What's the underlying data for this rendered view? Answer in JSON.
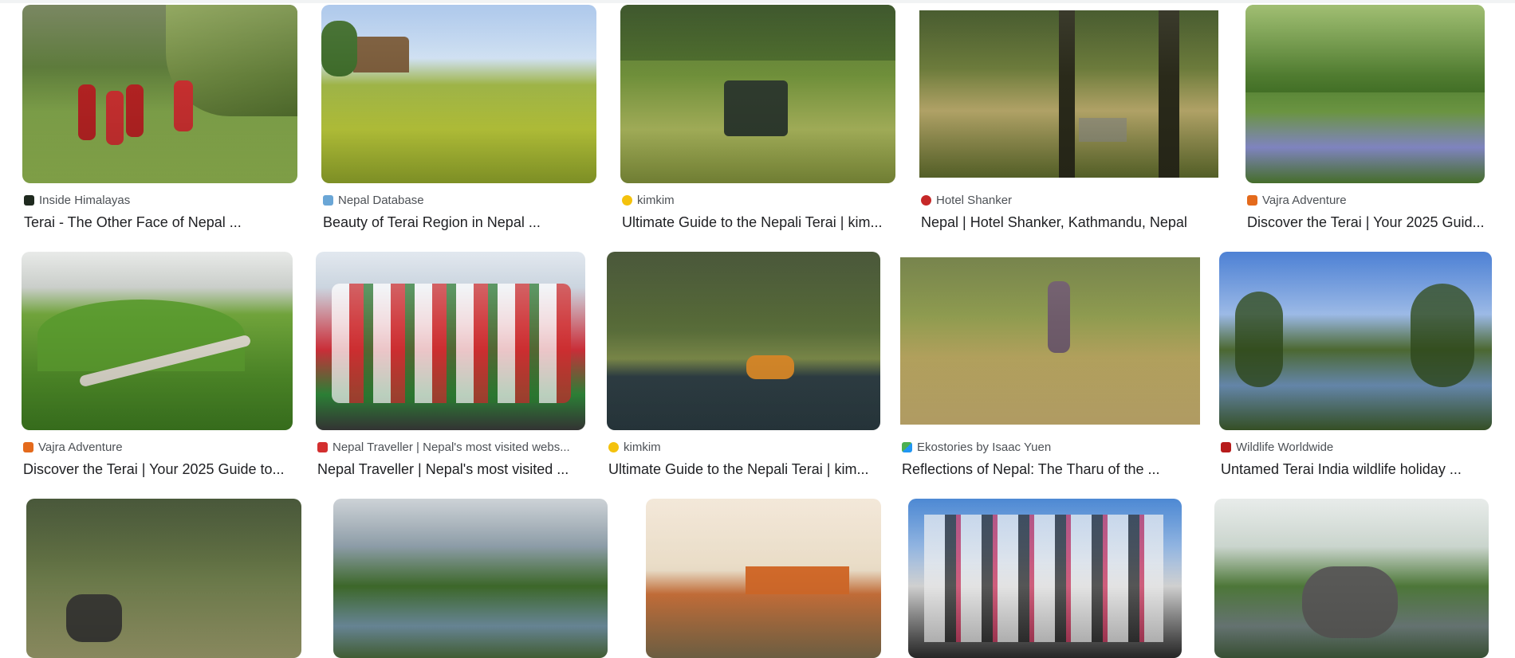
{
  "results": [
    {
      "source": "Inside Himalayas",
      "title": "Terai - The Other Face of Nepal ...",
      "favicon_color": "#1f2a1f",
      "favicon_icon": "inside-himalayas-favicon"
    },
    {
      "source": "Nepal Database",
      "title": "Beauty of Terai Region in Nepal ...",
      "favicon_color": "#6aa6d6",
      "favicon_icon": "nepal-database-favicon"
    },
    {
      "source": "kimkim",
      "title": "Ultimate Guide to the Nepali Terai | kim...",
      "favicon_color": "#f4c20d",
      "favicon_icon": "kimkim-favicon"
    },
    {
      "source": "Hotel Shanker",
      "title": "Nepal | Hotel Shanker, Kathmandu, Nepal",
      "favicon_color": "#c62828",
      "favicon_icon": "hotel-shanker-favicon"
    },
    {
      "source": "Vajra Adventure",
      "title": "Discover the Terai | Your 2025 Guid...",
      "favicon_color": "#e46a1c",
      "favicon_icon": "vajra-adventure-favicon"
    },
    {
      "source": "Vajra Adventure",
      "title": "Discover the Terai | Your 2025 Guide to...",
      "favicon_color": "#e46a1c",
      "favicon_icon": "vajra-adventure-favicon"
    },
    {
      "source": "Nepal Traveller | Nepal's most visited webs...",
      "title": "Nepal Traveller | Nepal's most visited ...",
      "favicon_color": "#d32f2f",
      "favicon_icon": "nepal-traveller-favicon"
    },
    {
      "source": "kimkim",
      "title": "Ultimate Guide to the Nepali Terai | kim...",
      "favicon_color": "#f4c20d",
      "favicon_icon": "kimkim-favicon"
    },
    {
      "source": "Ekostories by Isaac Yuen",
      "title": "Reflections of Nepal: The Tharu of the ...",
      "favicon_color": "#4caf50",
      "favicon_icon": "ekostories-favicon"
    },
    {
      "source": "Wildlife Worldwide",
      "title": "Untamed Terai India wildlife holiday ...",
      "favicon_color": "#b71c1c",
      "favicon_icon": "wildlife-worldwide-favicon"
    },
    {
      "source": "",
      "title": "",
      "favicon_color": "",
      "favicon_icon": ""
    },
    {
      "source": "",
      "title": "",
      "favicon_color": "",
      "favicon_icon": ""
    },
    {
      "source": "",
      "title": "",
      "favicon_color": "",
      "favicon_icon": ""
    },
    {
      "source": "",
      "title": "",
      "favicon_color": "",
      "favicon_icon": ""
    },
    {
      "source": "",
      "title": "",
      "favicon_color": "",
      "favicon_icon": ""
    }
  ]
}
